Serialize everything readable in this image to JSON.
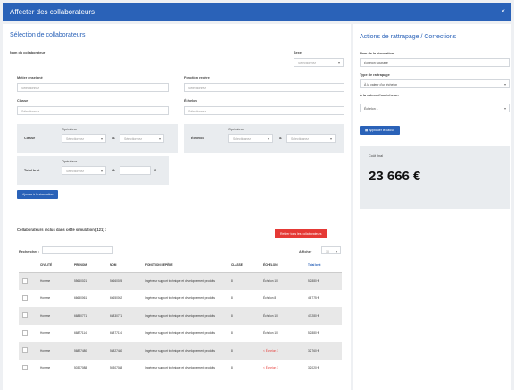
{
  "window": {
    "title": "Affecter des collaborateurs",
    "close": "×"
  },
  "selection": {
    "title": "Sélection de collaborateurs",
    "name_label": "Nom du collaborateur",
    "sexe_label": "Sexe",
    "sexe_value": "Sélectionnez",
    "metier_label": "Métier enseigné",
    "metier_value": "Sélectionnez",
    "fonction_label": "Fonction repère",
    "fonction_value": "Sélectionnez",
    "classe_label": "Classe",
    "classe_value": "Sélectionnez",
    "echelon_label": "Échelon",
    "echelon_value": "Sélectionnez",
    "operateur_label": "Opérateur",
    "classe_row_label": "Classe",
    "echelon_row_label": "Échelon",
    "salaire_label": "Total brut",
    "op_value": "Sélectionnez",
    "and_label": "&",
    "cmp_value": "Sélectionnez",
    "euro": "€",
    "add_button": "Ajouter à la simulation"
  },
  "collaborators": {
    "title": "Collaborateurs inclus dans cette simulation (121) :",
    "remove_all_button": "Retirer tous les collaborateurs",
    "search_label": "Rechercher :",
    "show_label": "Afficher",
    "show_value": "10",
    "columns": [
      "",
      "CIVILITÉ",
      "PRÉNOM",
      "NOM",
      "FONCTION REPÈRE",
      "CLASSE",
      "ÉCHELON",
      "Total brut"
    ],
    "rows": [
      {
        "civ": "Homme",
        "prenom": "55660021",
        "nom": "55660025",
        "fonction": "Ingénieur support technique et développement produits",
        "classe": "8",
        "echelon": "Échelon 10",
        "total": "52 880 €",
        "flag": false
      },
      {
        "civ": "Homme",
        "prenom": "66650061",
        "nom": "66650062",
        "fonction": "Ingénieur support technique et développement produits",
        "classe": "8",
        "echelon": "Échelon 8",
        "total": "46 775 €",
        "flag": false
      },
      {
        "civ": "Homme",
        "prenom": "66830771",
        "nom": "66830771",
        "fonction": "Ingénieur support technique et développement produits",
        "classe": "8",
        "echelon": "Échelon 10",
        "total": "47 280 €",
        "flag": false
      },
      {
        "civ": "Homme",
        "prenom": "66877114",
        "nom": "66877114",
        "fonction": "Ingénieur support technique et développement produits",
        "classe": "8",
        "echelon": "Échelon 10",
        "total": "52 880 €",
        "flag": false
      },
      {
        "civ": "Homme",
        "prenom": "56827480",
        "nom": "56827480",
        "fonction": "Ingénieur support technique et développement produits",
        "classe": "8",
        "echelon": "< Échelon 1",
        "total": "32 760 €",
        "flag": true
      },
      {
        "civ": "Homme",
        "prenom": "50307088",
        "nom": "50307088",
        "fonction": "Ingénieur support technique et développement produits",
        "classe": "8",
        "echelon": "< Échelon 1",
        "total": "32 020 €",
        "flag": true
      }
    ]
  },
  "actions": {
    "title": "Actions de rattrapage / Corrections",
    "simulation_label": "Nom de la simulation",
    "simulation_value": "Échelon souhaité",
    "type_label": "Type de rattrapage",
    "type_value": "À la valeur d'un échelon",
    "valeur_label": "À la valeur d'un échelon",
    "valeur_value": "Échelon 1",
    "apply_button": "Appliquer le calcul",
    "cost_label": "Coût final",
    "cost_value": "23 666 €"
  }
}
